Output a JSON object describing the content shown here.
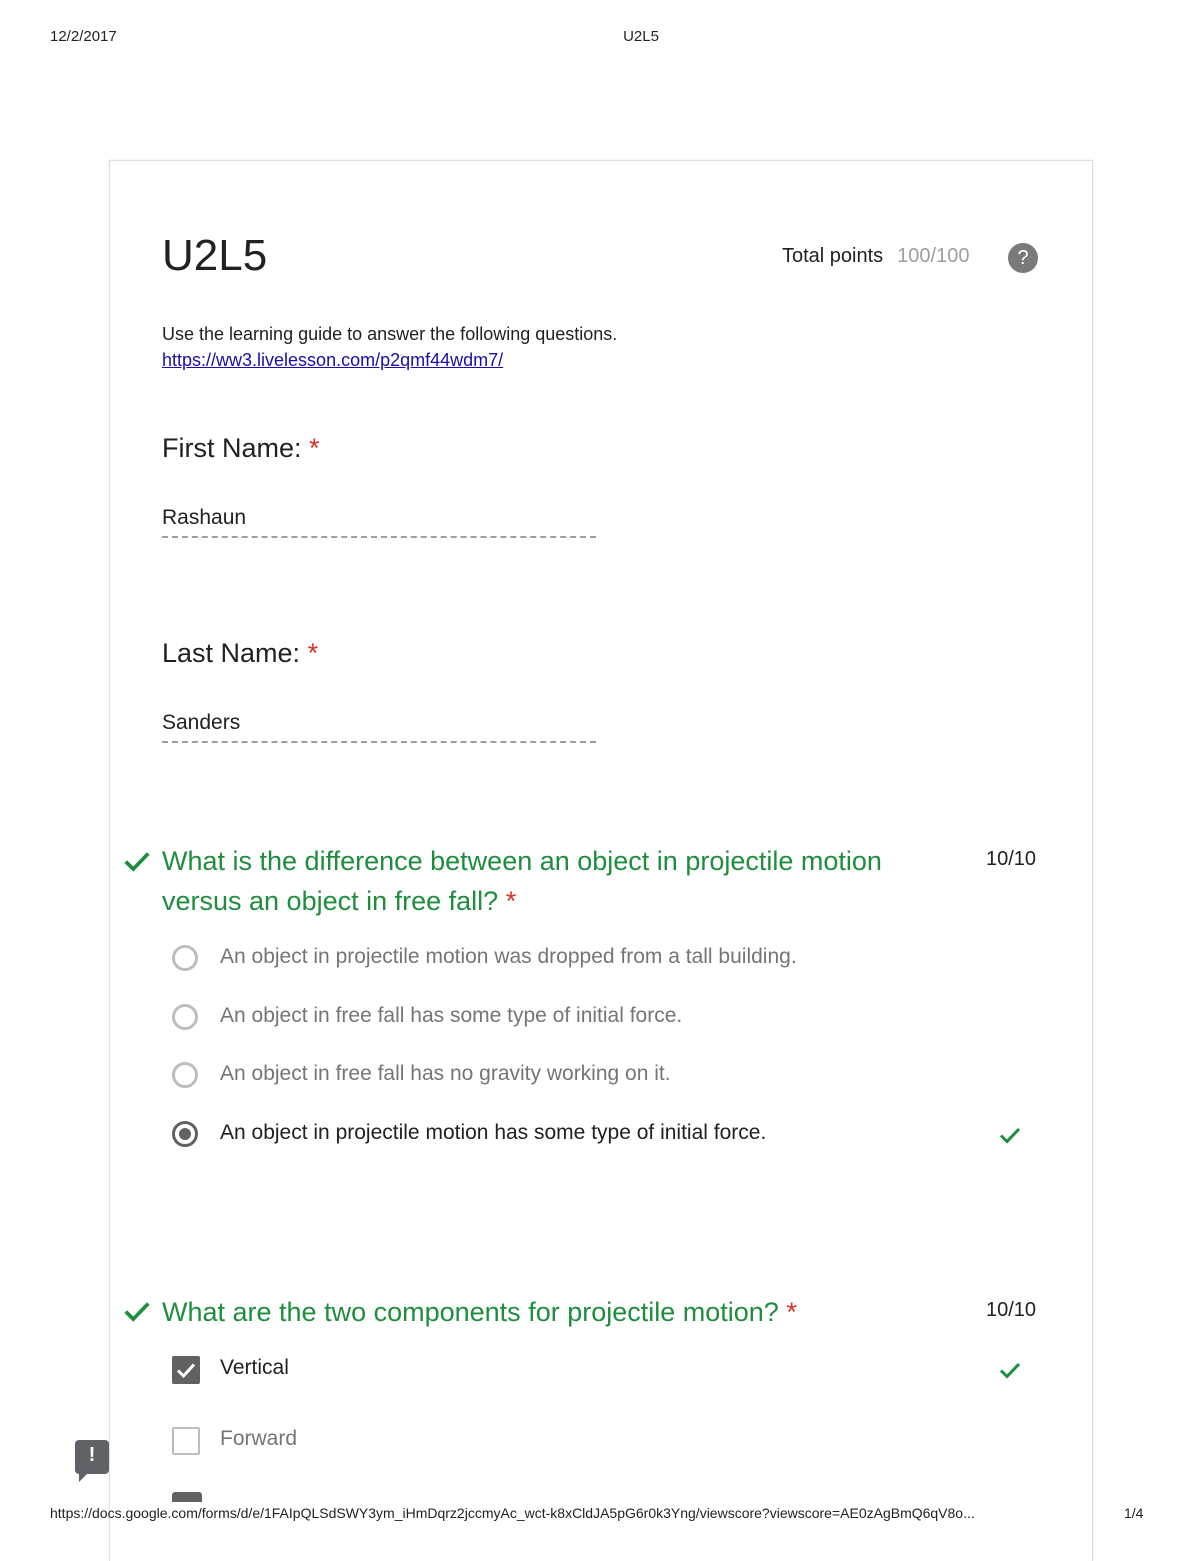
{
  "print_header": {
    "date": "12/2/2017",
    "title": "U2L5"
  },
  "print_footer": {
    "url": "https://docs.google.com/forms/d/e/1FAIpQLSdSWY3ym_iHmDqrz2jccmyAc_wct-k8xCldJA5pG6r0k3Yng/viewscore?viewscore=AE0zAgBmQ6qV8o...",
    "page": "1/4"
  },
  "form": {
    "title": "U2L5",
    "total_points_label": "Total points",
    "total_points_value": "100/100",
    "help_icon": "?",
    "description": "Use the learning guide to answer the following questions.",
    "link": "https://ww3.livelesson.com/p2qmf44wdm7/"
  },
  "fields": [
    {
      "label": "First Name:",
      "required": "*",
      "value": "Rashaun"
    },
    {
      "label": "Last Name:",
      "required": "*",
      "value": "Sanders"
    }
  ],
  "questions": [
    {
      "title": "What is the difference between an object in projectile motion versus an object in free fall?",
      "required": "*",
      "score": "10/10",
      "type": "radio",
      "options": [
        {
          "label": "An object in projectile motion was dropped from a tall building.",
          "selected": false,
          "correct_mark": false
        },
        {
          "label": "An object in free fall has some type of initial force.",
          "selected": false,
          "correct_mark": false
        },
        {
          "label": "An object in free fall has no gravity working on it.",
          "selected": false,
          "correct_mark": false
        },
        {
          "label": "An object in projectile motion has some type of initial force.",
          "selected": true,
          "correct_mark": true
        }
      ]
    },
    {
      "title": "What are the two components for projectile motion?",
      "required": "*",
      "score": "10/10",
      "type": "checkbox",
      "options": [
        {
          "label": "Vertical",
          "selected": true,
          "correct_mark": true
        },
        {
          "label": "Forward",
          "selected": false,
          "correct_mark": false
        }
      ]
    }
  ],
  "colors": {
    "correct_green": "#1e8e3e",
    "required_red": "#d93025",
    "link_blue": "#1a0dab"
  },
  "icons": {
    "question_correct": "check-icon",
    "option_correct": "check-icon",
    "feedback": "feedback-icon"
  },
  "feedback_button": "!"
}
